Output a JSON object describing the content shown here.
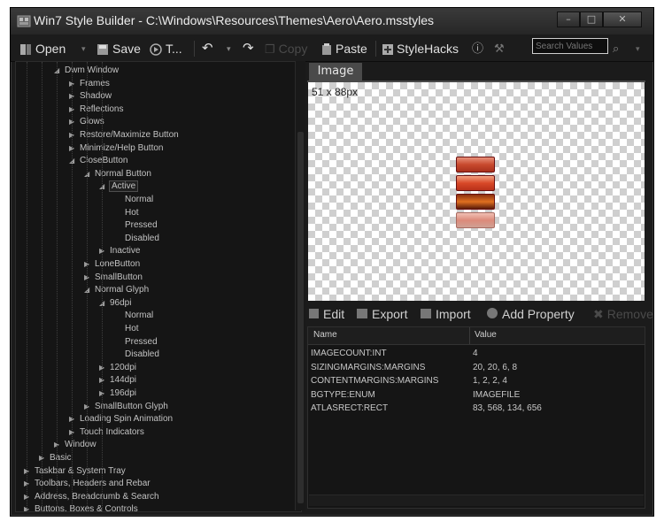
{
  "window": {
    "title": "Win7 Style Builder - C:\\Windows\\Resources\\Themes\\Aero\\Aero.msstyles",
    "caption_buttons": [
      "minimize",
      "maximize",
      "close"
    ]
  },
  "toolbar": {
    "open_label": "Open",
    "save_label": "Save",
    "test_label": "T...",
    "copy_label": "Copy",
    "paste_label": "Paste",
    "stylehacks_label": "StyleHacks",
    "search_placeholder": "Search Values"
  },
  "tree": {
    "nodes": [
      {
        "label": "Dwm Window",
        "level": 2,
        "expanded": true
      },
      {
        "label": "Frames",
        "level": 3,
        "expanded": false
      },
      {
        "label": "Shadow",
        "level": 3,
        "expanded": false
      },
      {
        "label": "Reflections",
        "level": 3,
        "expanded": false
      },
      {
        "label": "Glows",
        "level": 3,
        "expanded": false
      },
      {
        "label": "Restore/Maximize Button",
        "level": 3,
        "expanded": false
      },
      {
        "label": "Minimize/Help Button",
        "level": 3,
        "expanded": false
      },
      {
        "label": "CloseButton",
        "level": 3,
        "expanded": true
      },
      {
        "label": "Normal Button",
        "level": 4,
        "expanded": true
      },
      {
        "label": "Active",
        "level": 5,
        "expanded": true,
        "selected": true
      },
      {
        "label": "Normal",
        "level": 6
      },
      {
        "label": "Hot",
        "level": 6
      },
      {
        "label": "Pressed",
        "level": 6
      },
      {
        "label": "Disabled",
        "level": 6
      },
      {
        "label": "Inactive",
        "level": 5,
        "expanded": false
      },
      {
        "label": "LoneButton",
        "level": 4,
        "expanded": false
      },
      {
        "label": "SmallButton",
        "level": 4,
        "expanded": false
      },
      {
        "label": "Normal Glyph",
        "level": 4,
        "expanded": true
      },
      {
        "label": "96dpi",
        "level": 5,
        "expanded": true
      },
      {
        "label": "Normal",
        "level": 6
      },
      {
        "label": "Hot",
        "level": 6
      },
      {
        "label": "Pressed",
        "level": 6
      },
      {
        "label": "Disabled",
        "level": 6
      },
      {
        "label": "120dpi",
        "level": 5,
        "expanded": false
      },
      {
        "label": "144dpi",
        "level": 5,
        "expanded": false
      },
      {
        "label": "196dpi",
        "level": 5,
        "expanded": false
      },
      {
        "label": "SmallButton Glyph",
        "level": 4,
        "expanded": false
      },
      {
        "label": "Loading Spin Animation",
        "level": 3,
        "expanded": false
      },
      {
        "label": "Touch Indicators",
        "level": 3,
        "expanded": false
      },
      {
        "label": "Window",
        "level": 2,
        "expanded": false
      },
      {
        "label": "Basic",
        "level": 1,
        "expanded": false
      },
      {
        "label": "Taskbar & System Tray",
        "level": 0,
        "expanded": false
      },
      {
        "label": "Toolbars, Headers and Rebar",
        "level": 0,
        "expanded": false
      },
      {
        "label": "Address, Breadcrumb & Search",
        "level": 0,
        "expanded": false
      },
      {
        "label": "Buttons, Boxes & Controls",
        "level": 0,
        "expanded": false
      }
    ]
  },
  "image_panel": {
    "tab_label": "Image",
    "dimensions": "51 x 88px"
  },
  "properties": {
    "toolbar": {
      "edit_label": "Edit",
      "export_label": "Export",
      "import_label": "Import",
      "add_label": "Add Property",
      "remove_label": "Remove"
    },
    "columns": [
      "Name",
      "Value"
    ],
    "rows": [
      {
        "name": "IMAGECOUNT:INT",
        "value": "4"
      },
      {
        "name": "SIZINGMARGINS:MARGINS",
        "value": "20, 20, 6, 8"
      },
      {
        "name": "CONTENTMARGINS:MARGINS",
        "value": "1, 2, 2, 4"
      },
      {
        "name": "BGTYPE:ENUM",
        "value": "IMAGEFILE"
      },
      {
        "name": "ATLASRECT:RECT",
        "value": "83, 568, 134, 656"
      }
    ]
  },
  "colors": {
    "window_bg": "#1b1b1b",
    "text": "#c2c2c2",
    "close_button_red": "#c8402a"
  }
}
